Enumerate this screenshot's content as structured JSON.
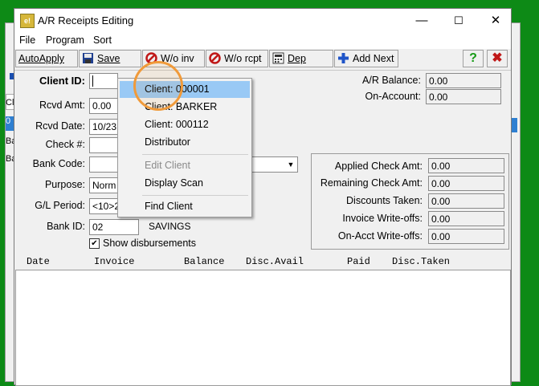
{
  "background_window": {
    "left_fragments": [
      "Cl",
      "0",
      "Ba",
      "Ba"
    ]
  },
  "window": {
    "title": "A/R Receipts Editing",
    "app_icon_text": "e!",
    "controls": {
      "minimize": "—",
      "maximize": "☐",
      "close": "✕"
    }
  },
  "menubar": {
    "items": [
      "File",
      "Program",
      "Sort"
    ]
  },
  "toolbar": {
    "autoapply": "AutoApply",
    "save": "Save",
    "wo_inv": "W/o inv",
    "wo_rcpt": "W/o rcpt",
    "dep": "Dep",
    "add_next": "Add Next",
    "help": "?",
    "exit": "✖"
  },
  "form": {
    "client_id_label": "Client ID:",
    "client_id_value": "",
    "rcvd_amt_label": "Rcvd Amt:",
    "rcvd_amt_value": "0.00",
    "rcvd_date_label": "Rcvd Date:",
    "rcvd_date_value": "10/23",
    "check_label": "Check #:",
    "check_value": "",
    "bank_code_label": "Bank Code:",
    "bank_code_value": "",
    "purpose_label": "Purpose:",
    "purpose_value": "Norm",
    "gl_period_label": "G/L Period:",
    "gl_period_value": "<10>2",
    "bank_id_label": "Bank ID:",
    "bank_id_value": "02",
    "bank_name": "SAVINGS",
    "show_disb_label": "Show disbursements",
    "show_disb_checked": true
  },
  "balances": {
    "ar_balance_label": "A/R Balance:",
    "ar_balance_value": "0.00",
    "on_account_label": "On-Account:",
    "on_account_value": "0.00"
  },
  "summary": {
    "applied_label": "Applied Check Amt:",
    "applied_value": "0.00",
    "remaining_label": "Remaining Check Amt:",
    "remaining_value": "0.00",
    "discounts_label": "Discounts Taken:",
    "discounts_value": "0.00",
    "inv_wo_label": "Invoice Write-offs:",
    "inv_wo_value": "0.00",
    "onacct_wo_label": "On-Acct Write-offs:",
    "onacct_wo_value": "0.00"
  },
  "grid": {
    "columns": [
      "Date",
      "Invoice",
      "Balance",
      "Disc.Avail",
      "Paid",
      "Disc.Taken"
    ]
  },
  "popup_menu": {
    "items": [
      {
        "label": "Client: 000001",
        "selected": true,
        "disabled": false
      },
      {
        "label": "Client: BARKER",
        "selected": false,
        "disabled": false
      },
      {
        "label": "Client: 000112",
        "selected": false,
        "disabled": false
      },
      {
        "label": "Distributor",
        "selected": false,
        "disabled": false
      },
      {
        "label": "Edit Client",
        "selected": false,
        "disabled": true
      },
      {
        "label": "Display Scan",
        "selected": false,
        "disabled": false
      },
      {
        "label": "Find Client",
        "selected": false,
        "disabled": false
      }
    ]
  },
  "colors": {
    "desktop_green": "#0d8a16",
    "selection_blue": "#99c9f5",
    "cursor_highlight": "#f09a3a"
  }
}
